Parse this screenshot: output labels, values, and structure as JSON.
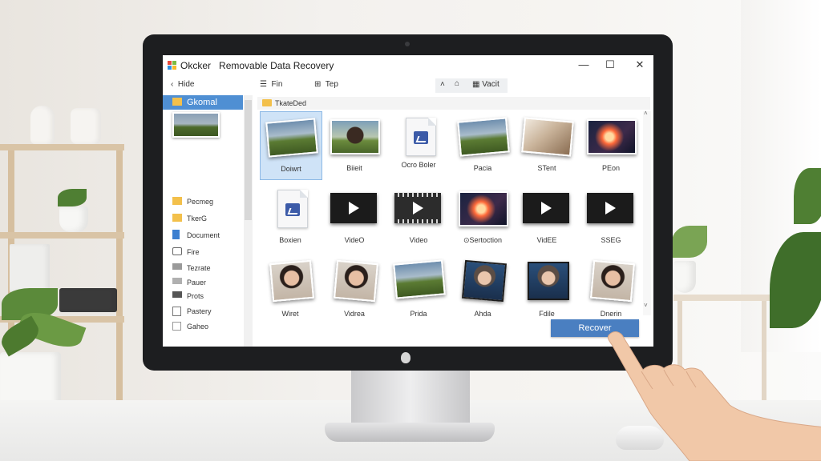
{
  "window": {
    "title_prefix": "Okcker",
    "title": "Removable Data Recovery",
    "minimize": "—",
    "maximize": "☐",
    "close": "✕"
  },
  "toolbar": {
    "hide_label": "Hide",
    "file_label": "Fin",
    "type_label": "Tep",
    "view_label": "Vacit"
  },
  "sidebar": {
    "items": [
      {
        "label": "Gkomal",
        "icon": "folder-icon",
        "selected": true
      },
      {
        "label": "Pecmeg",
        "icon": "folder-icon"
      },
      {
        "label": "TkerG",
        "icon": "folder-icon"
      },
      {
        "label": "Document",
        "icon": "document-icon"
      },
      {
        "label": "Fire",
        "icon": "share-icon"
      },
      {
        "label": "Tezrate",
        "icon": "drive-icon"
      },
      {
        "label": "Pauer",
        "icon": "drive-icon"
      },
      {
        "label": "Prots",
        "icon": "mail-icon"
      },
      {
        "label": "Pastery",
        "icon": "page-icon"
      },
      {
        "label": "Gaheo",
        "icon": "square-icon"
      }
    ]
  },
  "path": {
    "label": "TkateDed"
  },
  "files": {
    "row1": [
      {
        "name": "Doiwrt",
        "kind": "photo",
        "scene": "land"
      },
      {
        "name": "Biieit",
        "kind": "photo",
        "scene": "person"
      },
      {
        "name": "Ocro Boler",
        "kind": "doc"
      },
      {
        "name": "Pacia",
        "kind": "photo",
        "scene": "land"
      },
      {
        "name": "STent",
        "kind": "photo",
        "scene": "room"
      },
      {
        "name": "PEon",
        "kind": "photo",
        "scene": "space"
      }
    ],
    "row2": [
      {
        "name": "Boxien",
        "kind": "doc"
      },
      {
        "name": "VideO",
        "kind": "video"
      },
      {
        "name": "Video",
        "kind": "video-alt"
      },
      {
        "name": "Sertoction",
        "kind": "photo",
        "scene": "space"
      },
      {
        "name": "VidEE",
        "kind": "video"
      },
      {
        "name": "SSEG",
        "kind": "video"
      }
    ],
    "row3": [
      {
        "name": "Wiret",
        "kind": "photo",
        "scene": "portrait"
      },
      {
        "name": "Vidrea",
        "kind": "photo",
        "scene": "portrait"
      },
      {
        "name": "Prida",
        "kind": "photo",
        "scene": "land"
      },
      {
        "name": "Ahda",
        "kind": "photo",
        "scene": "portrait-dark"
      },
      {
        "name": "Fdile",
        "kind": "photo",
        "scene": "portrait-dark"
      },
      {
        "name": "Dnerin",
        "kind": "photo",
        "scene": "portrait"
      }
    ]
  },
  "actions": {
    "recover_label": "Recover"
  },
  "colors": {
    "accent": "#4a7fc1",
    "selection": "#4f8fd3",
    "bezel": "#1d1e20"
  }
}
